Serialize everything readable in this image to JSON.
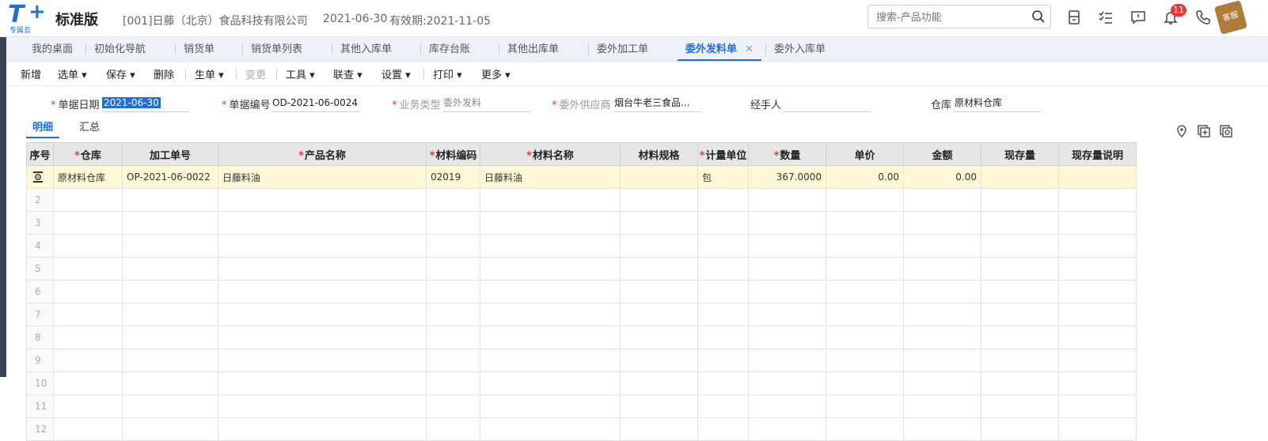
{
  "header": {
    "logo_main": "T",
    "logo_plus": "+",
    "logo_sub": "专属云",
    "edition": "标准版",
    "company": "[001]日藤（北京）食品科技有限公司",
    "date": "2021-06-30",
    "valid_until": "有效期:2021-11-05",
    "search_placeholder": "搜索-产品功能",
    "notification_count": "11",
    "service_label": "客服"
  },
  "tabs": [
    {
      "label": "我的桌面"
    },
    {
      "label": "初始化导航"
    },
    {
      "label": "销货单"
    },
    {
      "label": "销货单列表"
    },
    {
      "label": "其他入库单"
    },
    {
      "label": "库存台账"
    },
    {
      "label": "其他出库单"
    },
    {
      "label": "委外加工单"
    },
    {
      "label": "委外发料单",
      "active": true
    },
    {
      "label": "委外入库单"
    }
  ],
  "toolbar": {
    "new": "新增",
    "select": "选单",
    "save": "保存",
    "delete": "删除",
    "generate": "生单",
    "change": "变更",
    "tools": "工具",
    "link": "联查",
    "settings": "设置",
    "print": "打印",
    "more": "更多"
  },
  "form": {
    "date_label": "单据日期",
    "date_value": "2021-06-30",
    "number_label": "单据编号",
    "number_value": "OD-2021-06-0024",
    "biz_type_label": "业务类型",
    "biz_type_value": "委外发料",
    "supplier_label": "委外供应商",
    "supplier_value": "烟台牛老三食品...",
    "handler_label": "经手人",
    "handler_value": "",
    "warehouse_label": "仓库",
    "warehouse_value": "原材料仓库"
  },
  "subtabs": {
    "detail": "明细",
    "summary": "汇总"
  },
  "grid": {
    "columns": [
      {
        "label": "序号",
        "required": false
      },
      {
        "label": "仓库",
        "required": true
      },
      {
        "label": "加工单号",
        "required": false
      },
      {
        "label": "产品名称",
        "required": true
      },
      {
        "label": "材料编码",
        "required": true
      },
      {
        "label": "材料名称",
        "required": true
      },
      {
        "label": "材料规格",
        "required": false
      },
      {
        "label": "计量单位",
        "required": true
      },
      {
        "label": "数量",
        "required": true
      },
      {
        "label": "单价",
        "required": false
      },
      {
        "label": "金额",
        "required": false
      },
      {
        "label": "现存量",
        "required": false
      },
      {
        "label": "现存量说明",
        "required": false
      }
    ],
    "row1": {
      "warehouse": "原材料仓库",
      "order_no": "OP-2021-06-0022",
      "product": "日藤料油",
      "material_code": "02019",
      "material_name": "日藤料油",
      "spec": "",
      "unit": "包",
      "qty": "367.0000",
      "price": "0.00",
      "amount": "0.00",
      "stock": "",
      "stock_note": ""
    },
    "empty_rows": [
      "2",
      "3",
      "4",
      "5",
      "6",
      "7",
      "8",
      "9",
      "10",
      "11",
      "12"
    ]
  },
  "colors": {
    "accent": "#1f6fd6",
    "required": "#e53935",
    "selected_row": "#fff7d6"
  }
}
